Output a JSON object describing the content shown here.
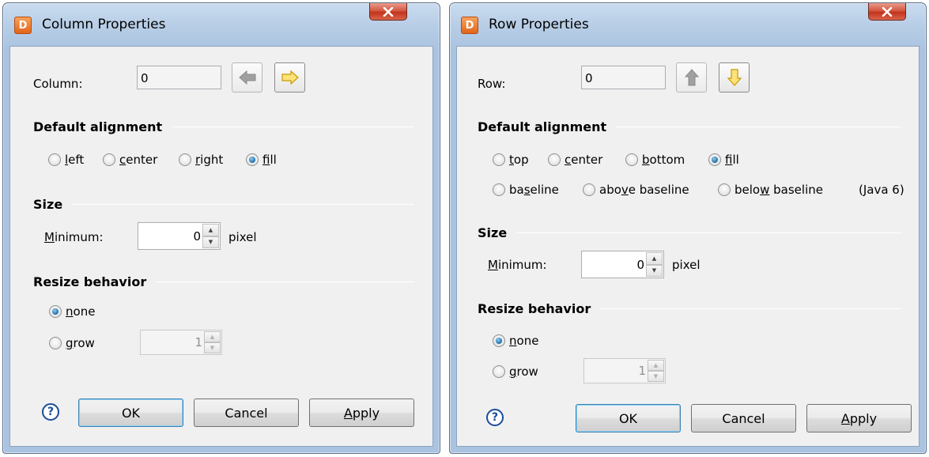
{
  "column_dialog": {
    "title": "Column Properties",
    "app_icon_letter": "D",
    "column_label": "Column:",
    "column_value": "0",
    "section_alignment": "Default alignment",
    "align_options": [
      {
        "pre": "",
        "key": "l",
        "post": "eft",
        "checked": false
      },
      {
        "pre": "",
        "key": "c",
        "post": "enter",
        "checked": false
      },
      {
        "pre": "",
        "key": "r",
        "post": "ight",
        "checked": false
      },
      {
        "pre": "",
        "key": "f",
        "post": "ill",
        "checked": true
      }
    ],
    "section_size": "Size",
    "minimum_key": "M",
    "minimum_rest": "inimum:",
    "minimum_value": "0",
    "unit": "pixel",
    "section_resize": "Resize behavior",
    "resize_none_key": "n",
    "resize_none_rest": "one",
    "resize_grow_key": "g",
    "resize_grow_rest": "row",
    "grow_value": "1",
    "help_glyph": "?",
    "ok": "OK",
    "cancel": "Cancel",
    "apply_key": "A",
    "apply_rest": "pply"
  },
  "row_dialog": {
    "title": "Row Properties",
    "app_icon_letter": "D",
    "row_label": "Row:",
    "row_value": "0",
    "section_alignment": "Default alignment",
    "align_top_key": "t",
    "align_top_rest": "op",
    "align_center_key": "c",
    "align_center_rest": "enter",
    "align_bottom_key": "b",
    "align_bottom_rest": "ottom",
    "align_fill_key": "f",
    "align_fill_rest": "ill",
    "align_baseline_pre": "ba",
    "align_baseline_key": "s",
    "align_baseline_post": "eline",
    "align_above_pre": "abo",
    "align_above_key": "v",
    "align_above_post": "e baseline",
    "align_below_pre": "belo",
    "align_below_key": "w",
    "align_below_post": " baseline",
    "java_note": "(Java 6)",
    "section_size": "Size",
    "minimum_key": "M",
    "minimum_rest": "inimum:",
    "minimum_value": "0",
    "unit": "pixel",
    "section_resize": "Resize behavior",
    "resize_none_key": "n",
    "resize_none_rest": "one",
    "resize_grow_key": "g",
    "resize_grow_rest": "row",
    "grow_value": "1",
    "help_glyph": "?",
    "ok": "OK",
    "cancel": "Cancel",
    "apply_key": "A",
    "apply_rest": "pply"
  },
  "colors": {
    "arrow_active": "#f2c200",
    "arrow_disabled": "#a0a0a0",
    "close_button": "#c2331c"
  }
}
